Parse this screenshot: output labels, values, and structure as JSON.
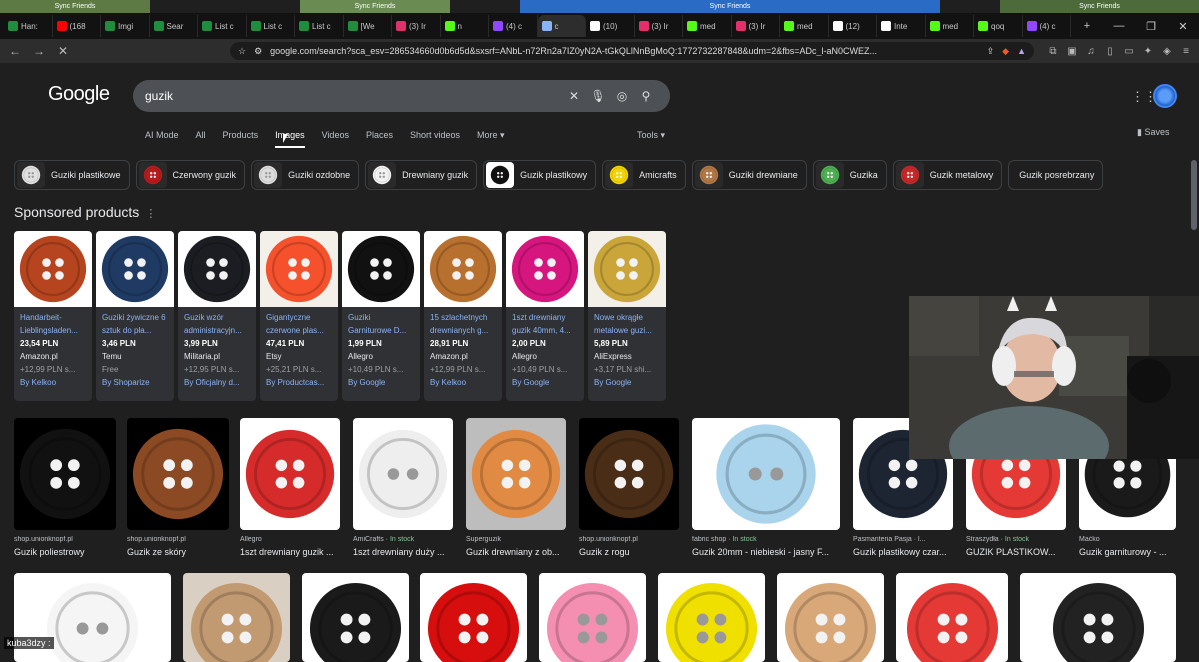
{
  "top_strips": {
    "s1": "Sync  Friends",
    "s2": "Sync  Friends",
    "s3": "Sync  Friends",
    "s4": "Sync Friends"
  },
  "tabs": [
    {
      "label": "Han:",
      "color": "#1e8e3e"
    },
    {
      "label": "(168",
      "color": "#ff0000"
    },
    {
      "label": "Imgi",
      "color": "#1e8e3e"
    },
    {
      "label": "Sear",
      "color": "#1e8e3e"
    },
    {
      "label": "List c",
      "color": "#1e8e3e"
    },
    {
      "label": "List c",
      "color": "#1e8e3e"
    },
    {
      "label": "List c",
      "color": "#1e8e3e"
    },
    {
      "label": "[We",
      "color": "#1e8e3e"
    },
    {
      "label": "(3) Ir",
      "color": "#e1306c"
    },
    {
      "label": "n",
      "color": "#53fc18"
    },
    {
      "label": "(4) c",
      "color": "#9146ff"
    },
    {
      "label": "c",
      "color": "#8ab4f8"
    },
    {
      "label": "(10)",
      "color": "#ffffff"
    },
    {
      "label": "(3) Ir",
      "color": "#e1306c"
    },
    {
      "label": "med",
      "color": "#53fc18"
    },
    {
      "label": "(3) Ir",
      "color": "#e1306c"
    },
    {
      "label": "med",
      "color": "#53fc18"
    },
    {
      "label": "(12)",
      "color": "#ffffff"
    },
    {
      "label": "Inte",
      "color": "#ffffff"
    },
    {
      "label": "med",
      "color": "#53fc18"
    },
    {
      "label": "qoq",
      "color": "#53fc18"
    },
    {
      "label": "(4) c",
      "color": "#9146ff"
    }
  ],
  "window_controls": {
    "new_tab": "+",
    "minimize": "—",
    "maximize": "❐",
    "close": "✕"
  },
  "toolbar": {
    "back": "←",
    "forward": "→",
    "stop": "✕",
    "url": "google.com/search?sca_esv=286534660d0b6d5d&sxsrf=ANbL-n72Rn2a7IZ0yN2A-tGkQLlNnBgMoQ:1772732287848&udm=2&fbs=ADc_l-aN0CWEZ..."
  },
  "google": {
    "logo": "Google",
    "query": "guzik",
    "nav": [
      "AI Mode",
      "All",
      "Products",
      "Images",
      "Videos",
      "Places",
      "Short videos",
      "More ▾"
    ],
    "selected_nav": "Images",
    "tools": "Tools ▾",
    "saves": "Saves"
  },
  "chips": [
    {
      "label": "Guziki plastikowe",
      "thumb": "#e0e0e0"
    },
    {
      "label": "Czerwony guzik",
      "thumb": "#b71c1c"
    },
    {
      "label": "Guziki ozdobne",
      "thumb": "#ddd"
    },
    {
      "label": "Drewniany guzik",
      "thumb": "#f2f2f2"
    },
    {
      "label": "Guzik plastikowy",
      "thumb": "#111"
    },
    {
      "label": "Amicrafts",
      "thumb": "#f4d400"
    },
    {
      "label": "Guziki drewniane",
      "thumb": "#b07845"
    },
    {
      "label": "Guzika",
      "thumb": "#4caf50"
    },
    {
      "label": "Guzik metalowy",
      "thumb": "#c62828"
    },
    {
      "label": "Guzik posrebrzany",
      "thumb": ""
    }
  ],
  "sponsored": {
    "title": "Sponsored products",
    "menu": "⋮",
    "items": [
      {
        "title": "Handarbeit-Lieblingsladen...",
        "price": "23,54 PLN",
        "store": "Amazon.pl",
        "ship": "+12,99 PLN s...",
        "by": "By Kelkoo",
        "color": "#b5441f"
      },
      {
        "title": "Guziki żywiczne 6 sztuk do pła...",
        "price": "3,46 PLN",
        "store": "Temu",
        "ship": "Free",
        "by": "By Shoparize",
        "color": "#1f3b63"
      },
      {
        "title": "Guzik wzór administracyjn...",
        "price": "3,99 PLN",
        "store": "Militaria.pl",
        "ship": "+12,95 PLN s...",
        "by": "By Oficjalny d...",
        "color": "#1c1d22"
      },
      {
        "title": "Gigantyczne czerwone plas...",
        "price": "47,41 PLN",
        "store": "Etsy",
        "ship": "+25,21 PLN s...",
        "by": "By Productcas...",
        "color": "#f4512c"
      },
      {
        "title": "Guziki Garniturowe D...",
        "price": "1,99 PLN",
        "store": "Allegro",
        "ship": "+10,49 PLN s...",
        "by": "By Google",
        "color": "#111111"
      },
      {
        "title": "15 szlachetnych drewnianych g...",
        "price": "28,91 PLN",
        "store": "Amazon.pl",
        "ship": "+12,99 PLN s...",
        "by": "By Kelkoo",
        "color": "#b8702e"
      },
      {
        "title": "1szt drewniany guzik 40mm, 4...",
        "price": "2,00 PLN",
        "store": "Allegro",
        "ship": "+10,49 PLN s...",
        "by": "By Google",
        "color": "#d6157f"
      },
      {
        "title": "Nowe okrągłe metalowe guzi...",
        "price": "5,89 PLN",
        "store": "AliExpress",
        "ship": "+3,17 PLN shi...",
        "by": "By Google",
        "color": "#caa53a"
      }
    ]
  },
  "results_row1": [
    {
      "source": "shop.unionknopf.pl",
      "stock": "",
      "caption": "Guzik poliestrowy",
      "color": "#111111"
    },
    {
      "source": "shop.unionknopf.pl",
      "stock": "",
      "caption": "Guzik ze skóry",
      "color": "#8b4a24"
    },
    {
      "source": "Allegro",
      "stock": "",
      "caption": "1szt drewniany guzik ...",
      "color": "#d62b2b"
    },
    {
      "source": "AmiCrafts",
      "stock": "In stock",
      "caption": "1szt drewniany duży ...",
      "color": "#eeeeee"
    },
    {
      "source": "Superguzik",
      "stock": "",
      "caption": "Guzik drewniany z ob...",
      "color": "#e08a44"
    },
    {
      "source": "shop.unionknopf.pl",
      "stock": "",
      "caption": "Guzik z rogu",
      "color": "#4a2d16"
    },
    {
      "source": "fabric shop",
      "stock": "In stock",
      "caption": "Guzik 20mm - niebieski - jasny F...",
      "color": "#a9d4ec"
    },
    {
      "source": "Pasmanteria Pasja · l...",
      "stock": "",
      "caption": "Guzik plastikowy czar...",
      "color": "#1d2432"
    },
    {
      "source": "Straszydła",
      "stock": "In stock",
      "caption": "GUZIK PLASTIKOW...",
      "color": "#e53935"
    },
    {
      "source": "Maćko",
      "stock": "",
      "caption": "Guzik garniturowy - ...",
      "color": "#1a1a1a"
    }
  ],
  "results_row2": [
    {
      "color": "#f5f5f5"
    },
    {
      "color": "#c29a72"
    },
    {
      "color": "#1a1a1a"
    },
    {
      "color": "#d60e0e"
    },
    {
      "color": "#f48fb1"
    },
    {
      "color": "#f0e000"
    },
    {
      "color": "#d9a878"
    },
    {
      "color": "#e53935"
    },
    {
      "color": "#222222"
    }
  ],
  "chat": {
    "user": "kuba3dzy :"
  }
}
